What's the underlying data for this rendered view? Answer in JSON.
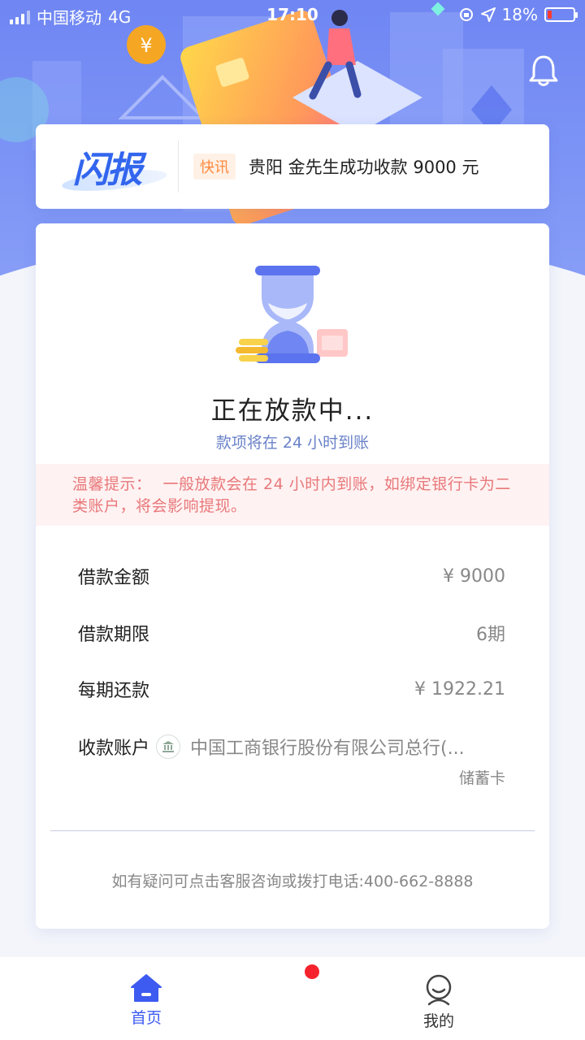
{
  "status_bar": {
    "carrier": "中国移动",
    "network": "4G",
    "time": "17:10",
    "battery_percent": "18%",
    "battery_level": 0.18,
    "battery_color": "#ff3b30"
  },
  "news": {
    "logo_text": "闪报",
    "tag": "快讯",
    "message": "贵阳 金先生成功收款 9000 元"
  },
  "loan_status": {
    "title": "正在放款中...",
    "subtitle": "款项将在 24 小时到账"
  },
  "tip": {
    "label": "温馨提示：",
    "text": "一般放款会在 24 小时内到账，如绑定银行卡为二类账户，将会影响提现。"
  },
  "details": {
    "amount_label": "借款金额",
    "amount_value": "¥ 9000",
    "term_label": "借款期限",
    "term_value": "6期",
    "installment_label": "每期还款",
    "installment_value": "¥ 1922.21",
    "account_label": "收款账户",
    "account_name": "中国工商银行股份有限公司总行(...",
    "card_type": "储蓄卡"
  },
  "contact": "如有疑问可点击客服咨询或拨打电话:400-662-8888",
  "tabs": {
    "home": "首页",
    "mine": "我的"
  },
  "colors": {
    "accent": "#3d5bf0",
    "hero": "#7e95f6",
    "tip_text": "#e8787a",
    "tip_bg": "#fff2f2",
    "badge": "#f5222d"
  }
}
